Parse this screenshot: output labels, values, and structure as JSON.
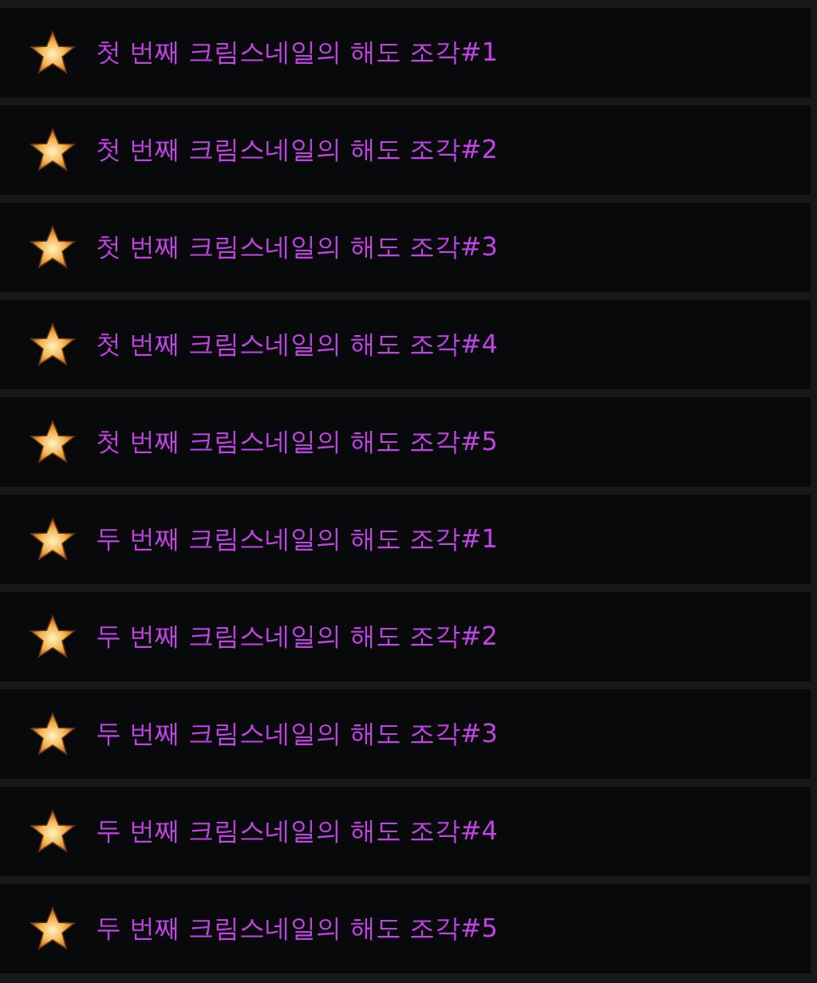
{
  "items": [
    {
      "label": "첫 번째 크림스네일의 해도 조각#1"
    },
    {
      "label": "첫 번째 크림스네일의 해도 조각#2"
    },
    {
      "label": "첫 번째 크림스네일의 해도 조각#3"
    },
    {
      "label": "첫 번째 크림스네일의 해도 조각#4"
    },
    {
      "label": "첫 번째 크림스네일의 해도 조각#5"
    },
    {
      "label": "두 번째 크림스네일의 해도 조각#1"
    },
    {
      "label": "두 번째 크림스네일의 해도 조각#2"
    },
    {
      "label": "두 번째 크림스네일의 해도 조각#3"
    },
    {
      "label": "두 번째 크림스네일의 해도 조각#4"
    },
    {
      "label": "두 번째 크림스네일의 해도 조각#5"
    }
  ]
}
